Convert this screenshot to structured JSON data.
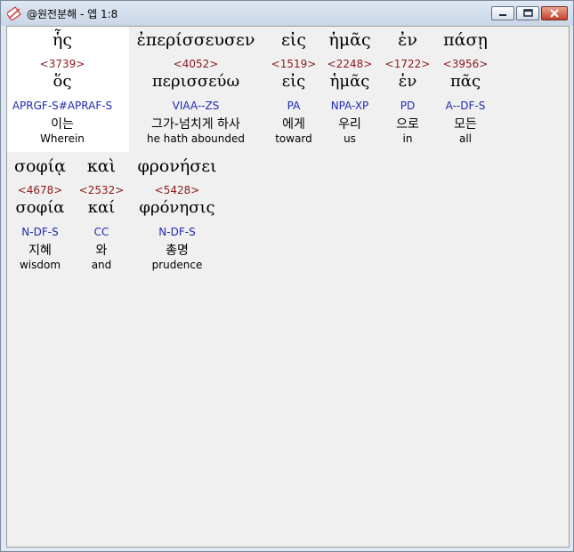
{
  "window": {
    "title": "@원전분해 - 엡 1:8"
  },
  "words": [
    {
      "greek": "ἧς",
      "strong": "<3739>",
      "lemma": "ὅς",
      "parse": "APRGF-S#APRAF-S",
      "korean": "이는",
      "english": "Wherein"
    },
    {
      "greek": "ἐπερίσσευσεν",
      "strong": "<4052>",
      "lemma": "περισσεύω",
      "parse": "VIAA--ZS",
      "korean": "그가-넘치게 하사",
      "english": "he hath abounded"
    },
    {
      "greek": "εἰς",
      "strong": "<1519>",
      "lemma": "εἰς",
      "parse": "PA",
      "korean": "에게",
      "english": "toward"
    },
    {
      "greek": "ἡμᾶς",
      "strong": "<2248>",
      "lemma": "ἡμᾶς",
      "parse": "NPA-XP",
      "korean": "우리",
      "english": "us"
    },
    {
      "greek": "ἐν",
      "strong": "<1722>",
      "lemma": "ἐν",
      "parse": "PD",
      "korean": "으로",
      "english": "in"
    },
    {
      "greek": "πάσῃ",
      "strong": "<3956>",
      "lemma": "πᾶς",
      "parse": "A--DF-S",
      "korean": "모든",
      "english": "all"
    },
    {
      "greek": "σοφίᾳ",
      "strong": "<4678>",
      "lemma": "σοφία",
      "parse": "N-DF-S",
      "korean": "지혜",
      "english": "wisdom"
    },
    {
      "greek": "καὶ",
      "strong": "<2532>",
      "lemma": "καί",
      "parse": "CC",
      "korean": "와",
      "english": "and"
    },
    {
      "greek": "φρονήσει",
      "strong": "<5428>",
      "lemma": "φρόνησις",
      "parse": "N-DF-S",
      "korean": "총명",
      "english": "prudence"
    }
  ]
}
